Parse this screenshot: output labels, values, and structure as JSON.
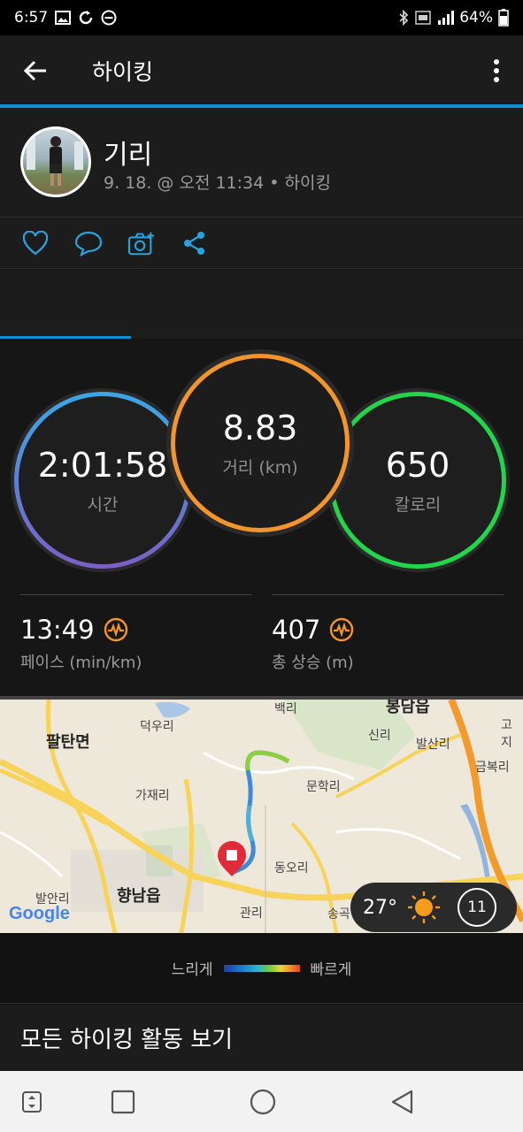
{
  "status_bar": {
    "time": "6:57",
    "battery": "64%"
  },
  "app_bar": {
    "title": "하이킹"
  },
  "activity": {
    "name": "기리",
    "meta": "9. 18. @ 오전 11:34 • 하이킹"
  },
  "stats": {
    "time": {
      "value": "2:01:58",
      "label": "시간"
    },
    "distance": {
      "value": "8.83",
      "label": "거리 (km)"
    },
    "calories": {
      "value": "650",
      "label": "칼로리"
    },
    "pace": {
      "value": "13:49",
      "label": "페이스 (min/km)"
    },
    "ascent": {
      "value": "407",
      "label": "총 상승 (m)"
    }
  },
  "map": {
    "labels": {
      "paltan": "팔탄면",
      "deokwoo": "덕우리",
      "gajae": "가재리",
      "hyangnam": "향남읍",
      "balan": "발안리",
      "baekri": "백리",
      "sinri": "신리",
      "balsan": "발산리",
      "munhak": "문학리",
      "dongo": "동오리",
      "gwanri": "관리",
      "geumbok": "금복리",
      "songgok": "송곡",
      "goji": "고지",
      "top_cut": "봉담읍"
    },
    "google": "Google",
    "weather": {
      "temp": "27°",
      "wind": "11"
    }
  },
  "legend": {
    "slow": "느리게",
    "fast": "빠르게"
  },
  "view_all": "모든 하이킹 활동 보기",
  "colors": {
    "accent": "#0f8fd6",
    "time_ring": "#4aa3e0",
    "distance_ring": "#f3952b",
    "calorie_ring": "#22d64c"
  }
}
